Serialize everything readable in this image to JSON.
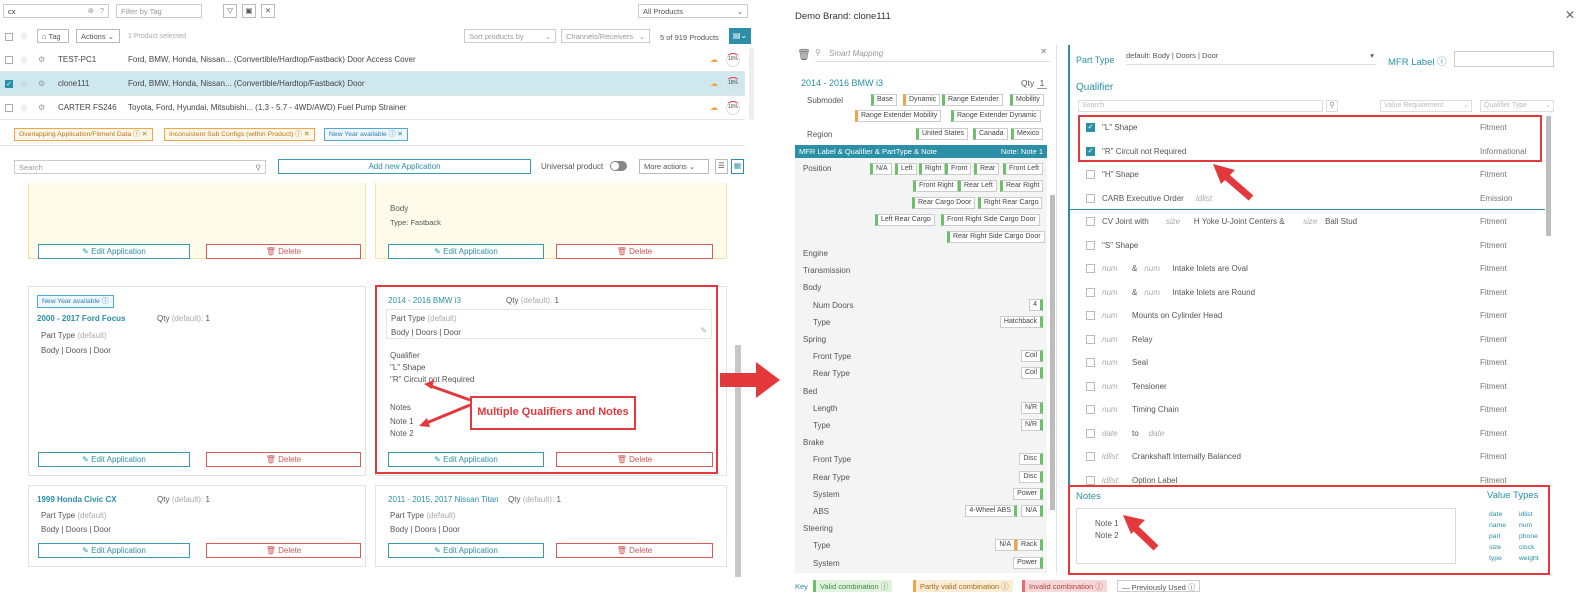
{
  "left": {
    "search_value": "cx",
    "filter_tag_placeholder": "Filter by Tag",
    "all_products": "All Products",
    "tag_label": "Tag",
    "actions_label": "Actions",
    "selected_count": "1 Product selected",
    "sort_placeholder": "Sort products by",
    "channels_placeholder": "Channels/Receivers",
    "count_label": "5 of 919 Products",
    "rows": [
      {
        "sku": "TEST-PC1",
        "desc": "Ford, BMW, Honda, Nissan... (Convertible/Hardtop/Fastback) Door Access Cover",
        "pct": "16%",
        "selected": false
      },
      {
        "sku": "clone111",
        "desc": "Ford, BMW, Honda, Nissan... (Convertible/Hardtop/Fastback) Door",
        "pct": "18%",
        "selected": true
      },
      {
        "sku": "CARTER FS246",
        "desc": "Toyota, Ford, Hyundai, Mitsubishi... (1.3 - 5.7 - 4WD/AWD) Fuel Pump Strainer",
        "pct": "16%",
        "selected": false
      }
    ],
    "filter_tags": [
      "Overlapping Application/Fitment Data",
      "Inconsistent Sub Configs (within Product)",
      "New Year available"
    ],
    "app_search_placeholder": "Search",
    "add_application": "Add new Application",
    "universal_product": "Universal product",
    "more_actions": "More actions",
    "edit_application": "Edit Application",
    "delete": "Delete",
    "card_top_right": {
      "body_label": "Body",
      "type_label": "Type:",
      "type_value": "Fastback"
    },
    "card_ford": {
      "badge": "New Year available",
      "title": "2000 - 2017 Ford Focus",
      "qty_label": "Qty",
      "qty_default": "(default):",
      "qty_value": "1",
      "part_type_label": "Part Type",
      "part_type_default": "(default)",
      "part_type_value": "Body | Doors | Door"
    },
    "card_bmw": {
      "title": "2014 - 2016 BMW i3",
      "qty_label": "Qty",
      "qty_default": "(default):",
      "qty_value": "1",
      "part_type_label": "Part Type",
      "part_type_default": "(default)",
      "part_type_value": "Body | Doors | Door",
      "qualifier_label": "Qualifier",
      "qualifiers": [
        "\"L\" Shape",
        "\"R\" Circuit not Required"
      ],
      "notes_label": "Notes",
      "notes": [
        "Note 1",
        "Note 2"
      ]
    },
    "callout": "Multiple Qualifiers and Notes",
    "card_honda": {
      "title": "1999 Honda Civic CX",
      "qty_label": "Qty",
      "qty_default": "(default):",
      "qty_value": "1",
      "part_type_label": "Part Type",
      "part_type_default": "(default)",
      "part_type_value": "Body | Doors | Door"
    },
    "card_nissan": {
      "title": "2011 - 2015, 2017 Nissan Titan",
      "qty_label": "Qty",
      "qty_default": "(default):",
      "qty_value": "1",
      "part_type_label": "Part Type",
      "part_type_default": "(default)",
      "part_type_value": "Body | Doors | Door"
    }
  },
  "right": {
    "title": "Demo Brand: clone111",
    "smart_mapping": "Smart Mapping",
    "vehicle": "2014 - 2016 BMW i3",
    "qty_label": "Qty",
    "qty_value": "1",
    "submodel_label": "Submodel",
    "submodels": [
      "Base",
      "Dynamic",
      "Range Extender",
      "Mobility",
      "Range Extender Mobility",
      "Range Extender Dynamic"
    ],
    "region_label": "Region",
    "regions": [
      "United States",
      "Canada",
      "Mexico"
    ],
    "mfr_bar": "MFR Label & Qualifier & PartType & Note",
    "mfr_bar_note": "Note: Note 1",
    "position_label": "Position",
    "positions": [
      "N/A",
      "Left",
      "Right",
      "Front",
      "Rear",
      "Front Left",
      "Front Right",
      "Rear Left",
      "Rear Right",
      "Rear Cargo Door",
      "Right Rear Cargo",
      "Left Rear Cargo",
      "Front Right Side Cargo Door",
      "Rear Right Side Cargo Door"
    ],
    "attributes": [
      {
        "label": "Engine",
        "type": "section"
      },
      {
        "label": "Transmission",
        "type": "section"
      },
      {
        "label": "Body",
        "type": "section"
      },
      {
        "label": "Num Doors",
        "type": "sub",
        "value": "4"
      },
      {
        "label": "Type",
        "type": "sub",
        "value": "Hatchback"
      },
      {
        "label": "Spring",
        "type": "section"
      },
      {
        "label": "Front Type",
        "type": "sub",
        "value": "Coil"
      },
      {
        "label": "Rear Type",
        "type": "sub",
        "value": "Coil"
      },
      {
        "label": "Bed",
        "type": "section"
      },
      {
        "label": "Length",
        "type": "sub",
        "value": "N/R"
      },
      {
        "label": "Type",
        "type": "sub",
        "value": "N/R"
      },
      {
        "label": "Brake",
        "type": "section"
      },
      {
        "label": "Front Type",
        "type": "sub",
        "value": "Disc"
      },
      {
        "label": "Rear Type",
        "type": "sub",
        "value": "Disc"
      },
      {
        "label": "System",
        "type": "sub",
        "value": "Power"
      },
      {
        "label": "ABS",
        "type": "sub",
        "value": "4-Wheel ABS",
        "value2": "N/A"
      },
      {
        "label": "Steering",
        "type": "section"
      },
      {
        "label": "Type",
        "type": "sub",
        "value": "N/A",
        "value2": "Rack"
      },
      {
        "label": "System",
        "type": "sub",
        "value": "Power"
      }
    ],
    "part_type_label": "Part Type",
    "part_type_value": "default: Body  |  Doors  |  Door",
    "mfr_label": "MFR Label",
    "qualifier_heading": "Qualifier",
    "qual_search_placeholder": "Search",
    "value_requirement": "Value Requirement",
    "qualifier_type": "Qualifier Type",
    "qualifiers": [
      {
        "text": "\"L\" Shape",
        "type": "Fitment",
        "checked": true
      },
      {
        "text": "\"R\" Circuit not Required",
        "type": "Informational",
        "checked": true
      },
      {
        "text": "\"H\" Shape",
        "type": "Fitment",
        "checked": false
      },
      {
        "text": "CARB Executive Order",
        "extra": "idlist",
        "type": "Emission",
        "checked": false
      },
      {
        "text": "CV Joint with",
        "extra": "size",
        "text2": "H Yoke U-Joint Centers &",
        "extra2": "size",
        "text3": "Ball Stud",
        "type": "Fitment",
        "checked": false
      },
      {
        "text": "\"S\" Shape",
        "type": "Fitment",
        "checked": false
      },
      {
        "pre": "num",
        "text": "&",
        "extra": "num",
        "text2": "Intake Inlets are Oval",
        "type": "Fitment",
        "checked": false
      },
      {
        "pre": "num",
        "text": "&",
        "extra": "num",
        "text2": "Intake Inlets are Round",
        "type": "Fitment",
        "checked": false
      },
      {
        "pre": "num",
        "text": "Mounts on Cylinder Head",
        "type": "Fitment",
        "checked": false
      },
      {
        "pre": "num",
        "text": "Relay",
        "type": "Fitment",
        "checked": false
      },
      {
        "pre": "num",
        "text": "Seal",
        "type": "Fitment",
        "checked": false
      },
      {
        "pre": "num",
        "text": "Tensioner",
        "type": "Fitment",
        "checked": false
      },
      {
        "pre": "num",
        "text": "Timing Chain",
        "type": "Fitment",
        "checked": false
      },
      {
        "pre": "date",
        "text": "to",
        "extra": "date",
        "type": "Fitment",
        "checked": false
      },
      {
        "pre": "idlist",
        "text": "Crankshaft Internally Balanced",
        "type": "Fitment",
        "checked": false
      },
      {
        "pre": "idlist",
        "text": "Option Label",
        "type": "Fitment",
        "checked": false
      }
    ],
    "notes_heading": "Notes",
    "notes": [
      "Note 1",
      "Note 2"
    ],
    "value_types_heading": "Value Types",
    "value_types": [
      "date",
      "idlist",
      "name",
      "num",
      "part",
      "phone",
      "size",
      "clock",
      "type",
      "weight"
    ],
    "key_label": "Key",
    "key_valid": "Valid combination",
    "key_partly": "Partly valid combination",
    "key_invalid": "Invalid combination",
    "key_prev": "Previously Used",
    "colors": {
      "teal": "#2b8fa6",
      "annotation_red": "#e4393c",
      "valid": "#6cc06c",
      "partly": "#f0a54a",
      "invalid": "#e86b6b"
    }
  }
}
